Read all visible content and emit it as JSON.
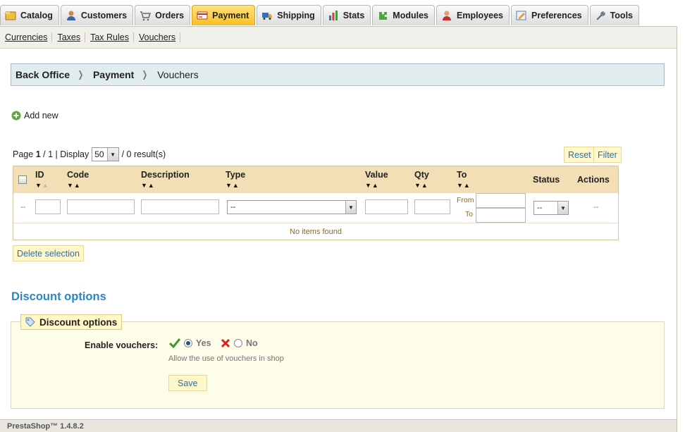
{
  "tabs": [
    {
      "label": "Catalog",
      "icon": "catalog-icon",
      "active": false
    },
    {
      "label": "Customers",
      "icon": "customers-icon",
      "active": false
    },
    {
      "label": "Orders",
      "icon": "orders-icon",
      "active": false
    },
    {
      "label": "Payment",
      "icon": "payment-icon",
      "active": true
    },
    {
      "label": "Shipping",
      "icon": "shipping-icon",
      "active": false
    },
    {
      "label": "Stats",
      "icon": "stats-icon",
      "active": false
    },
    {
      "label": "Modules",
      "icon": "modules-icon",
      "active": false
    },
    {
      "label": "Employees",
      "icon": "employees-icon",
      "active": false
    },
    {
      "label": "Preferences",
      "icon": "preferences-icon",
      "active": false
    },
    {
      "label": "Tools",
      "icon": "tools-icon",
      "active": false
    }
  ],
  "subnav": [
    "Currencies",
    "Taxes",
    "Tax Rules",
    "Vouchers"
  ],
  "breadcrumb": {
    "root": "Back Office",
    "parent": "Payment",
    "current": "Vouchers"
  },
  "add_new": "Add new",
  "pager": {
    "page_label": "Page",
    "page": "1",
    "total_pages": "/ 1",
    "display_label": "| Display",
    "per_page": "50",
    "results": "/ 0 result(s)"
  },
  "buttons": {
    "reset": "Reset",
    "filter": "Filter",
    "delete_selection": "Delete selection",
    "save": "Save"
  },
  "table": {
    "columns": {
      "id": "ID",
      "code": "Code",
      "description": "Description",
      "type": "Type",
      "value": "Value",
      "qty": "Qty",
      "to": "To",
      "status": "Status",
      "actions": "Actions"
    },
    "filters": {
      "type_value": "--",
      "status_value": "--",
      "from_label": "From",
      "to_label": "To",
      "placeholder_dash": "--",
      "actions_dash": "--"
    },
    "empty_message": "No items found"
  },
  "discount": {
    "section_title": "Discount options",
    "legend": "Discount options",
    "label": "Enable vouchers:",
    "yes": "Yes",
    "no": "No",
    "selected": "Yes",
    "hint": "Allow the use of vouchers in shop"
  },
  "footer": "PrestaShop™ 1.4.8.2",
  "colors": {
    "active_tab": "#f7bf24",
    "link_blue": "#2a6fb2",
    "section_blue": "#2a86c6",
    "table_head": "#f3dfb5"
  }
}
